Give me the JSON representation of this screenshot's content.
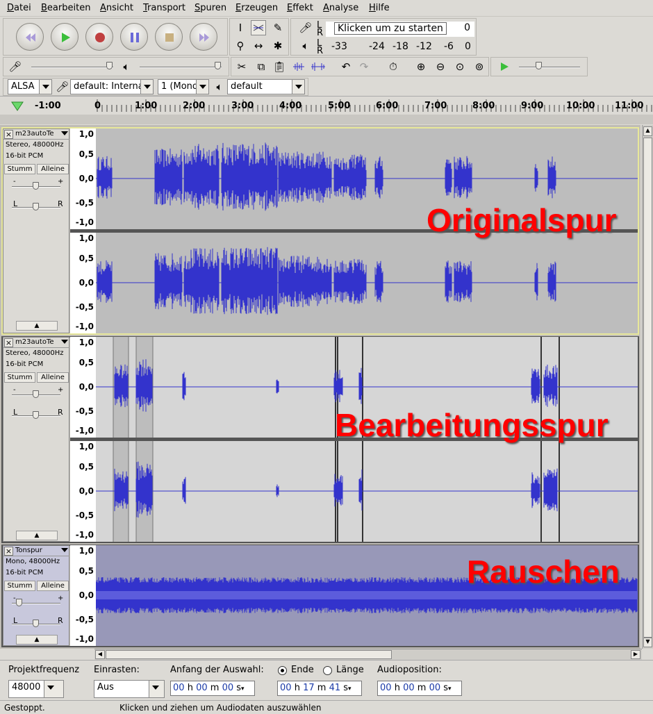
{
  "menu": [
    "Datei",
    "Bearbeiten",
    "Ansicht",
    "Transport",
    "Spuren",
    "Erzeugen",
    "Effekt",
    "Analyse",
    "Hilfe"
  ],
  "meter": {
    "click_to_start": "Klicken um zu starten",
    "click_zero": "0",
    "lr_top_l": "L",
    "lr_top_r": "R",
    "lr_bot_l": "L",
    "lr_bot_r": "R",
    "scale": [
      "-33",
      "-24",
      "-18",
      "-12",
      "-6",
      "0"
    ]
  },
  "device": {
    "host": "ALSA",
    "input": "default: Interna",
    "channels": "1 (Mono",
    "output": "default"
  },
  "ruler": [
    "-1:00",
    "0",
    "1:00",
    "2:00",
    "3:00",
    "4:00",
    "5:00",
    "6:00",
    "7:00",
    "8:00",
    "9:00",
    "10:00",
    "11:00"
  ],
  "tracks": [
    {
      "name": "m23autoTe",
      "info1": "Stereo, 48000Hz",
      "info2": "16-bit PCM",
      "mute": "Stumm",
      "solo": "Alleine",
      "pan_l": "L",
      "pan_r": "R",
      "gain_minus": "-",
      "gain_plus": "+",
      "label": "Originalspur"
    },
    {
      "name": "m23autoTe",
      "info1": "Stereo, 48000Hz",
      "info2": "16-bit PCM",
      "mute": "Stumm",
      "solo": "Alleine",
      "pan_l": "L",
      "pan_r": "R",
      "gain_minus": "-",
      "gain_plus": "+",
      "label": "Bearbeitungsspur"
    },
    {
      "name": "Tonspur",
      "info1": "Mono, 48000Hz",
      "info2": "16-bit PCM",
      "mute": "Stumm",
      "solo": "Alleine",
      "pan_l": "L",
      "pan_r": "R",
      "gain_minus": "-",
      "gain_plus": "+",
      "label": "Rauschen"
    }
  ],
  "vscale": [
    "1,0",
    "0,5",
    "0,0",
    "-0,5",
    "-1,0"
  ],
  "selection": {
    "rate_label": "Projektfrequenz",
    "rate_value": "48000",
    "snap_label": "Einrasten:",
    "snap_value": "Aus",
    "start_label": "Anfang der Auswahl:",
    "end_label": "Ende",
    "length_label": "Länge",
    "audiopos_label": "Audioposition:",
    "start_time": [
      "00",
      "h",
      "00",
      "m",
      "00",
      "s"
    ],
    "end_time": [
      "00",
      "h",
      "17",
      "m",
      "41",
      "s"
    ],
    "pos_time": [
      "00",
      "h",
      "00",
      "m",
      "00",
      "s"
    ]
  },
  "status": {
    "left": "Gestoppt.",
    "right": "Klicken und ziehen um Audiodaten auszuwählen"
  },
  "colors": {
    "wave": "#3333cc",
    "selected_border": "#e8e89a",
    "red_label": "#ff0000"
  }
}
